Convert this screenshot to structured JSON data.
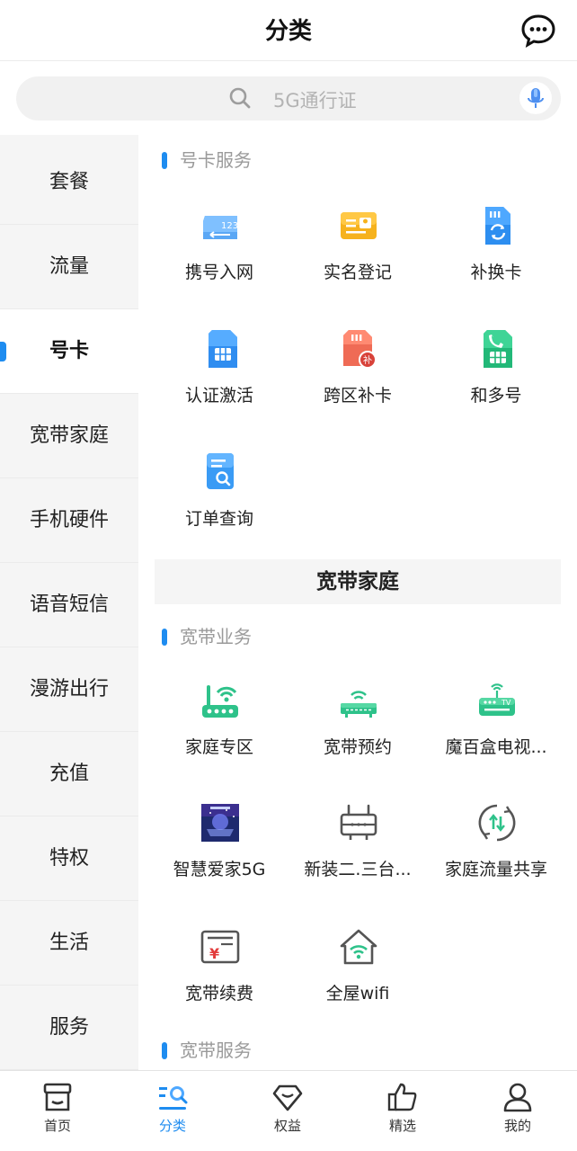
{
  "header": {
    "title": "分类",
    "message_icon": "chat-bubble-icon"
  },
  "search": {
    "placeholder": "5G通行证",
    "search_icon": "search-icon",
    "voice_icon": "microphone-icon"
  },
  "sidebar": {
    "items": [
      {
        "label": "套餐",
        "active": false
      },
      {
        "label": "流量",
        "active": false
      },
      {
        "label": "号卡",
        "active": true
      },
      {
        "label": "宽带家庭",
        "active": false
      },
      {
        "label": "手机硬件",
        "active": false
      },
      {
        "label": "语音短信",
        "active": false
      },
      {
        "label": "漫游出行",
        "active": false
      },
      {
        "label": "充值",
        "active": false
      },
      {
        "label": "特权",
        "active": false
      },
      {
        "label": "生活",
        "active": false
      },
      {
        "label": "服务",
        "active": false
      }
    ]
  },
  "content": {
    "section_card_service": {
      "title": "号卡服务",
      "items": [
        {
          "label": "携号入网",
          "icon": "number-transfer-card-icon"
        },
        {
          "label": "实名登记",
          "icon": "id-card-icon"
        },
        {
          "label": "补换卡",
          "icon": "sim-replace-icon"
        },
        {
          "label": "认证激活",
          "icon": "sim-activate-icon"
        },
        {
          "label": "跨区补卡",
          "icon": "sim-cross-region-icon"
        },
        {
          "label": "和多号",
          "icon": "sim-multi-number-icon"
        },
        {
          "label": "订单查询",
          "icon": "order-search-icon"
        }
      ]
    },
    "category_banner": "宽带家庭",
    "section_broadband_business": {
      "title": "宽带业务",
      "items": [
        {
          "label": "家庭专区",
          "icon": "router-icon"
        },
        {
          "label": "宽带预约",
          "icon": "modem-icon"
        },
        {
          "label": "魔百盒电视...",
          "icon": "tv-box-icon"
        },
        {
          "label": "智慧爱家5G",
          "icon": "smart-home-thumbnail-icon"
        },
        {
          "label": "新装二.三台...",
          "icon": "set-top-box-icon"
        },
        {
          "label": "家庭流量共享",
          "icon": "data-share-icon"
        },
        {
          "label": "宽带续费",
          "icon": "renew-bill-icon"
        },
        {
          "label": "全屋wifi",
          "icon": "home-wifi-icon"
        }
      ]
    },
    "section_broadband_service": {
      "title": "宽带服务"
    }
  },
  "tabbar": {
    "tabs": [
      {
        "label": "首页",
        "icon": "home-store-icon",
        "active": false
      },
      {
        "label": "分类",
        "icon": "category-search-icon",
        "active": true
      },
      {
        "label": "权益",
        "icon": "diamond-icon",
        "active": false
      },
      {
        "label": "精选",
        "icon": "thumbs-up-icon",
        "active": false
      },
      {
        "label": "我的",
        "icon": "person-icon",
        "active": false
      }
    ]
  },
  "colors": {
    "accent": "#1e8cf0",
    "green": "#2ec28a",
    "sidebar_bg": "#f5f5f5"
  }
}
